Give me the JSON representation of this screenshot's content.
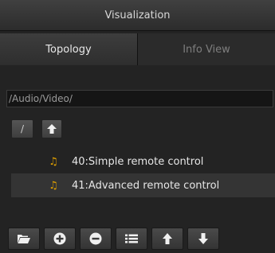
{
  "panel": {
    "title": "Visualization"
  },
  "tabs": [
    {
      "label": "Topology",
      "active": true
    },
    {
      "label": "Info View",
      "active": false
    }
  ],
  "path": {
    "value": "/Audio/Video/"
  },
  "nav": {
    "root_label": "/",
    "up_icon": "arrow-up-icon"
  },
  "files": [
    {
      "label": "40:Simple remote control",
      "icon": "music-note-icon"
    },
    {
      "label": "41:Advanced remote control",
      "icon": "music-note-icon"
    }
  ],
  "toolbar": {
    "buttons": [
      "folder-open-icon",
      "add-circle-icon",
      "remove-circle-icon",
      "list-icon",
      "arrow-up-icon",
      "arrow-down-icon"
    ]
  },
  "colors": {
    "background": "#232323",
    "note_accent": "#e0a000"
  }
}
